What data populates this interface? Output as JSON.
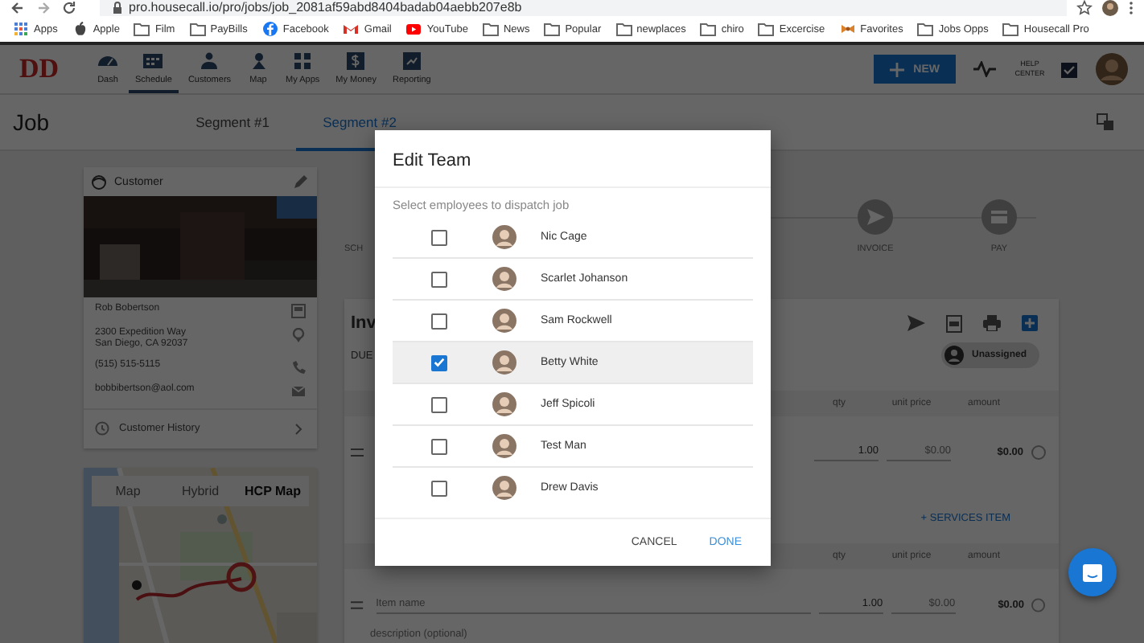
{
  "browser": {
    "url": "pro.housecall.io/pro/jobs/job_2081af59abd8404badab04aebb207e8b",
    "bookmarks": [
      {
        "label": "Apps",
        "kind": "apps"
      },
      {
        "label": "Apple",
        "kind": "apple"
      },
      {
        "label": "Film",
        "kind": "folder"
      },
      {
        "label": "PayBills",
        "kind": "folder"
      },
      {
        "label": "Facebook",
        "kind": "facebook"
      },
      {
        "label": "Gmail",
        "kind": "gmail"
      },
      {
        "label": "YouTube",
        "kind": "youtube"
      },
      {
        "label": "News",
        "kind": "folder"
      },
      {
        "label": "Popular",
        "kind": "folder"
      },
      {
        "label": "newplaces",
        "kind": "folder"
      },
      {
        "label": "chiro",
        "kind": "folder"
      },
      {
        "label": "Excercise",
        "kind": "folder"
      },
      {
        "label": "Favorites",
        "kind": "bow"
      },
      {
        "label": "Jobs Opps",
        "kind": "folder"
      },
      {
        "label": "Housecall Pro",
        "kind": "folder"
      }
    ]
  },
  "header": {
    "logo": "DD",
    "nav": [
      {
        "label": "Dash",
        "kind": "gauge",
        "selected": false
      },
      {
        "label": "Schedule",
        "kind": "calendar",
        "selected": true
      },
      {
        "label": "Customers",
        "kind": "people",
        "selected": false
      },
      {
        "label": "Map",
        "kind": "pin",
        "selected": false
      },
      {
        "label": "My Apps",
        "kind": "grid",
        "selected": false
      },
      {
        "label": "My Money",
        "kind": "money",
        "selected": false
      },
      {
        "label": "Reporting",
        "kind": "report",
        "selected": false
      }
    ],
    "new_button": "NEW",
    "help_center": "HELP CENTER"
  },
  "job": {
    "title": "Job",
    "segments": [
      {
        "label": "Segment #1",
        "selected": false
      },
      {
        "label": "Segment #2",
        "selected": true
      }
    ]
  },
  "customer": {
    "heading": "Customer",
    "name": "Rob Bobertson",
    "address": "2300 Expedition Way\nSan Diego, CA 92037",
    "phone": "(515) 515-5115",
    "email": "bobbibertson@aol.com",
    "history": "Customer History"
  },
  "map": {
    "tabs": [
      {
        "label": "Map",
        "selected": false
      },
      {
        "label": "Hybrid",
        "selected": false
      },
      {
        "label": "HCP Map",
        "selected": true
      }
    ]
  },
  "workflow": {
    "steps": [
      {
        "label": "SCH",
        "kind": "label"
      },
      {
        "label": "INVOICE",
        "kind": "send"
      },
      {
        "label": "PAY",
        "kind": "pay"
      }
    ]
  },
  "invoice": {
    "title": "Inv",
    "due": "DUE",
    "assignee": "Unassigned",
    "sections": [
      {
        "columns": [
          "qty",
          "unit price",
          "amount"
        ],
        "qty": "1.00",
        "unit_price_placeholder": "$0.00",
        "amount": "$0.00",
        "add_link": "+ SERVICES ITEM"
      },
      {
        "columns": [
          "qty",
          "unit price",
          "amount"
        ],
        "item_placeholder": "Item name",
        "description_placeholder": "description (optional)",
        "qty": "1.00",
        "unit_price_placeholder": "$0.00",
        "amount": "$0.00"
      }
    ]
  },
  "dialog": {
    "title": "Edit Team",
    "subtitle": "Select employees to dispatch job",
    "employees": [
      {
        "name": "Nic Cage",
        "checked": false,
        "hovered": false
      },
      {
        "name": "Scarlet Johanson",
        "checked": false,
        "hovered": false
      },
      {
        "name": "Sam Rockwell",
        "checked": false,
        "hovered": false
      },
      {
        "name": "Betty White",
        "checked": true,
        "hovered": true
      },
      {
        "name": "Jeff Spicoli",
        "checked": false,
        "hovered": false
      },
      {
        "name": "Test Man",
        "checked": false,
        "hovered": false
      },
      {
        "name": "Drew Davis",
        "checked": false,
        "hovered": false
      }
    ],
    "buttons": [
      {
        "label": "CANCEL",
        "kind": "secondary"
      },
      {
        "label": "DONE",
        "kind": "primary"
      }
    ]
  }
}
